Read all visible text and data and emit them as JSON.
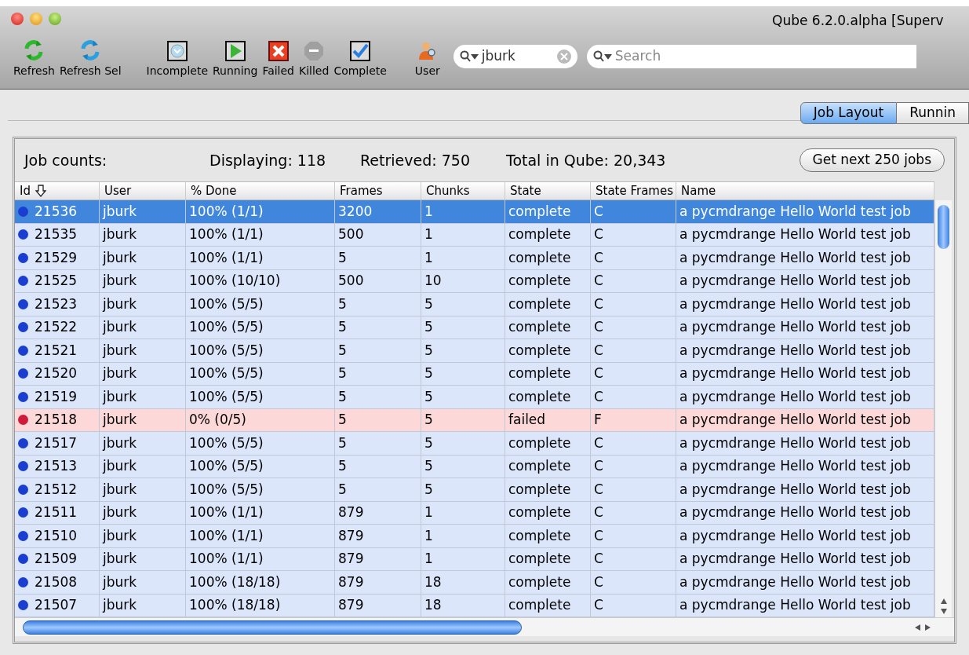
{
  "window": {
    "title": "Qube 6.2.0.alpha [Superv"
  },
  "toolbar": [
    {
      "kind": "refresh",
      "label": "Refresh"
    },
    {
      "kind": "refresh_sel",
      "label": "Refresh Sel"
    },
    {
      "kind": "incomplete",
      "label": "Incomplete"
    },
    {
      "kind": "running",
      "label": "Running"
    },
    {
      "kind": "failed",
      "label": "Failed"
    },
    {
      "kind": "killed",
      "label": "Killed"
    },
    {
      "kind": "complete",
      "label": "Complete"
    },
    {
      "kind": "user",
      "label": "User"
    }
  ],
  "user_filter": {
    "value": "jburk"
  },
  "search": {
    "placeholder": "Search"
  },
  "tabs": [
    {
      "label": "Job Layout",
      "selected": true
    },
    {
      "label": "Runnin",
      "selected": false
    }
  ],
  "job_counts": {
    "label": "Job counts:",
    "displaying": "Displaying: 118",
    "retrieved": "Retrieved: 750",
    "total": "Total in Qube: 20,343",
    "button": "Get next 250 jobs"
  },
  "table": {
    "columns": [
      "Id",
      "User",
      "% Done",
      "Frames",
      "Chunks",
      "State",
      "State Frames",
      "Name"
    ],
    "rows": [
      {
        "id": "21536",
        "user": "jburk",
        "done": "100% (1/1)",
        "frames": "3200",
        "chunks": "1",
        "state": "complete",
        "state_frames": "C",
        "name": "a pycmdrange Hello World test job",
        "color": "#1a3fd0",
        "kind": "normal",
        "selected": true
      },
      {
        "id": "21535",
        "user": "jburk",
        "done": "100% (1/1)",
        "frames": "500",
        "chunks": "1",
        "state": "complete",
        "state_frames": "C",
        "name": "a pycmdrange Hello World test job",
        "color": "#1a3fd0",
        "kind": "normal",
        "selected": false
      },
      {
        "id": "21529",
        "user": "jburk",
        "done": "100% (1/1)",
        "frames": "5",
        "chunks": "1",
        "state": "complete",
        "state_frames": "C",
        "name": "a pycmdrange Hello World test job",
        "color": "#1a3fd0",
        "kind": "normal",
        "selected": false
      },
      {
        "id": "21525",
        "user": "jburk",
        "done": "100% (10/10)",
        "frames": "500",
        "chunks": "10",
        "state": "complete",
        "state_frames": "C",
        "name": "a pycmdrange Hello World test job",
        "color": "#1a3fd0",
        "kind": "normal",
        "selected": false
      },
      {
        "id": "21523",
        "user": "jburk",
        "done": "100% (5/5)",
        "frames": "5",
        "chunks": "5",
        "state": "complete",
        "state_frames": "C",
        "name": "a pycmdrange Hello World test job",
        "color": "#1a3fd0",
        "kind": "normal",
        "selected": false
      },
      {
        "id": "21522",
        "user": "jburk",
        "done": "100% (5/5)",
        "frames": "5",
        "chunks": "5",
        "state": "complete",
        "state_frames": "C",
        "name": "a pycmdrange Hello World test job",
        "color": "#1a3fd0",
        "kind": "normal",
        "selected": false
      },
      {
        "id": "21521",
        "user": "jburk",
        "done": "100% (5/5)",
        "frames": "5",
        "chunks": "5",
        "state": "complete",
        "state_frames": "C",
        "name": "a pycmdrange Hello World test job",
        "color": "#1a3fd0",
        "kind": "normal",
        "selected": false
      },
      {
        "id": "21520",
        "user": "jburk",
        "done": "100% (5/5)",
        "frames": "5",
        "chunks": "5",
        "state": "complete",
        "state_frames": "C",
        "name": "a pycmdrange Hello World test job",
        "color": "#1a3fd0",
        "kind": "normal",
        "selected": false
      },
      {
        "id": "21519",
        "user": "jburk",
        "done": "100% (5/5)",
        "frames": "5",
        "chunks": "5",
        "state": "complete",
        "state_frames": "C",
        "name": "a pycmdrange Hello World test job",
        "color": "#1a3fd0",
        "kind": "normal",
        "selected": false
      },
      {
        "id": "21518",
        "user": "jburk",
        "done": "0% (0/5)",
        "frames": "5",
        "chunks": "5",
        "state": "failed",
        "state_frames": "F",
        "name": "a pycmdrange Hello World test job",
        "color": "#d01a3a",
        "kind": "failed",
        "selected": false
      },
      {
        "id": "21517",
        "user": "jburk",
        "done": "100% (5/5)",
        "frames": "5",
        "chunks": "5",
        "state": "complete",
        "state_frames": "C",
        "name": "a pycmdrange Hello World test job",
        "color": "#1a3fd0",
        "kind": "normal",
        "selected": false
      },
      {
        "id": "21513",
        "user": "jburk",
        "done": "100% (5/5)",
        "frames": "5",
        "chunks": "5",
        "state": "complete",
        "state_frames": "C",
        "name": "a pycmdrange Hello World test job",
        "color": "#1a3fd0",
        "kind": "normal",
        "selected": false
      },
      {
        "id": "21512",
        "user": "jburk",
        "done": "100% (5/5)",
        "frames": "5",
        "chunks": "5",
        "state": "complete",
        "state_frames": "C",
        "name": "a pycmdrange Hello World test job",
        "color": "#1a3fd0",
        "kind": "normal",
        "selected": false
      },
      {
        "id": "21511",
        "user": "jburk",
        "done": "100% (1/1)",
        "frames": "879",
        "chunks": "1",
        "state": "complete",
        "state_frames": "C",
        "name": "a pycmdrange Hello World test job",
        "color": "#1a3fd0",
        "kind": "normal",
        "selected": false
      },
      {
        "id": "21510",
        "user": "jburk",
        "done": "100% (1/1)",
        "frames": "879",
        "chunks": "1",
        "state": "complete",
        "state_frames": "C",
        "name": "a pycmdrange Hello World test job",
        "color": "#1a3fd0",
        "kind": "normal",
        "selected": false
      },
      {
        "id": "21509",
        "user": "jburk",
        "done": "100% (1/1)",
        "frames": "879",
        "chunks": "1",
        "state": "complete",
        "state_frames": "C",
        "name": "a pycmdrange Hello World test job",
        "color": "#1a3fd0",
        "kind": "normal",
        "selected": false
      },
      {
        "id": "21508",
        "user": "jburk",
        "done": "100% (18/18)",
        "frames": "879",
        "chunks": "18",
        "state": "complete",
        "state_frames": "C",
        "name": "a pycmdrange Hello World test job",
        "color": "#1a3fd0",
        "kind": "normal",
        "selected": false
      },
      {
        "id": "21507",
        "user": "jburk",
        "done": "100% (18/18)",
        "frames": "879",
        "chunks": "18",
        "state": "complete",
        "state_frames": "C",
        "name": "a pycmdrange Hello World test job",
        "color": "#1a3fd0",
        "kind": "normal",
        "selected": false
      }
    ]
  }
}
